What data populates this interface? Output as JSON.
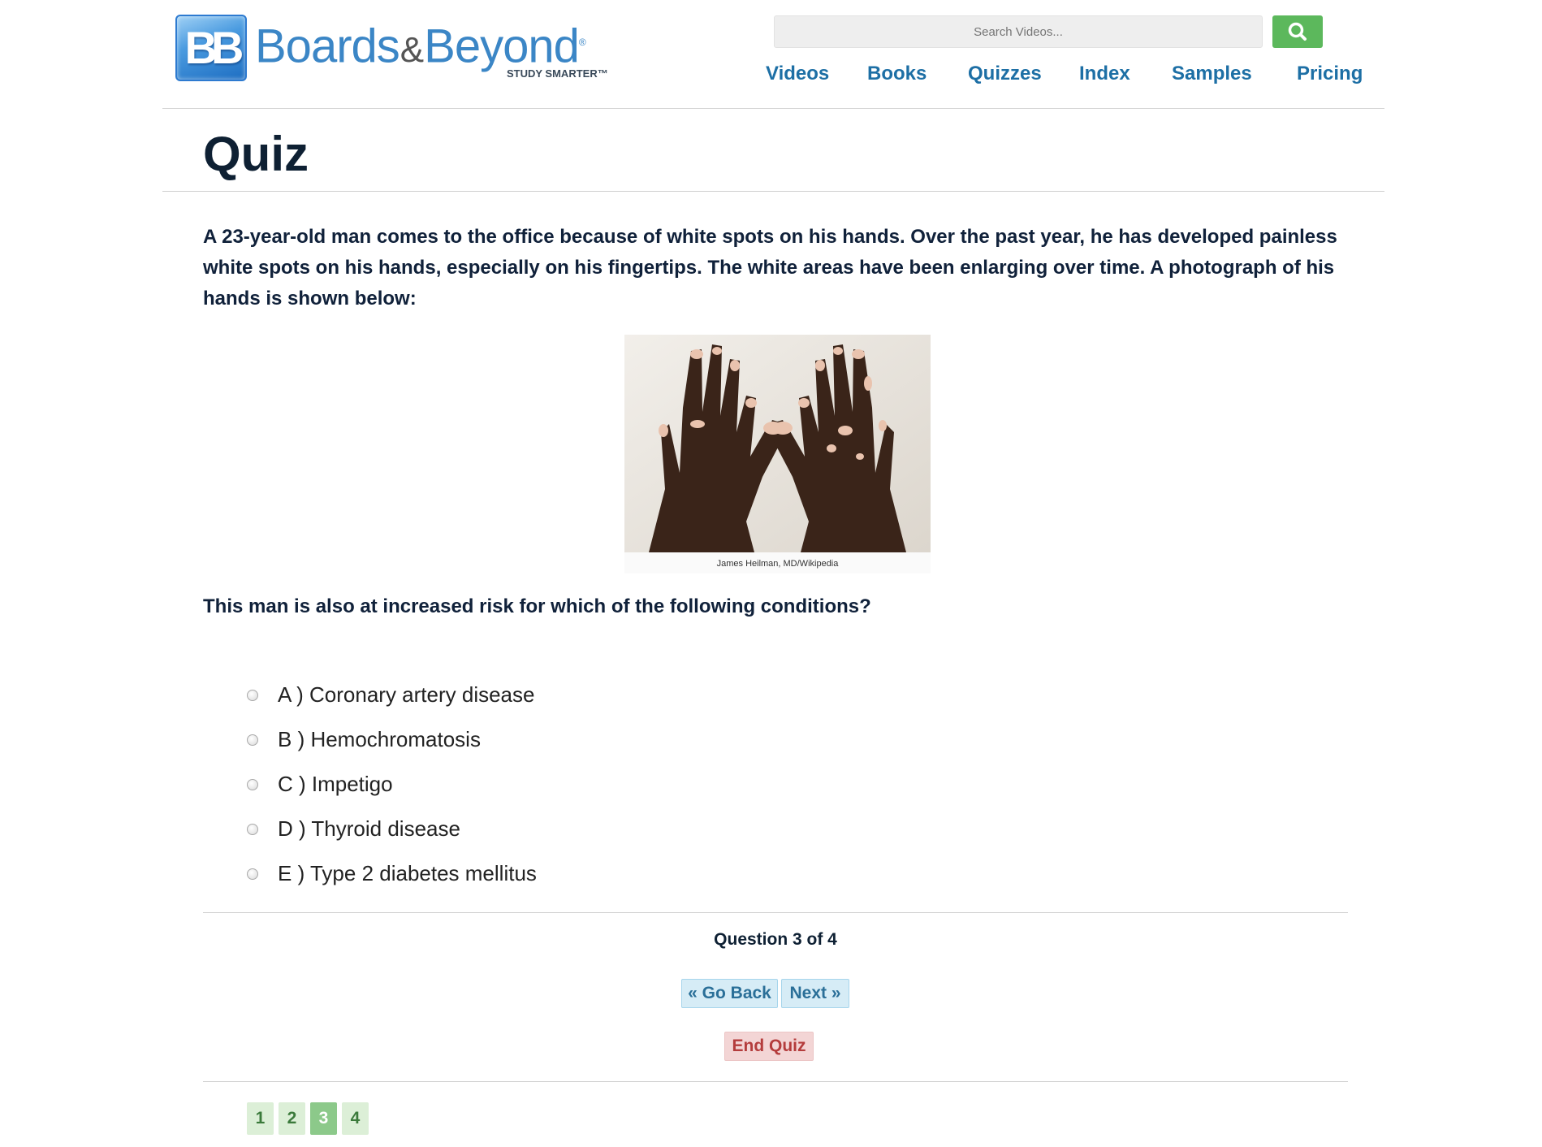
{
  "brand": {
    "mark": "BB",
    "name_left": "Boards",
    "name_amp": "&",
    "name_right": "Beyond",
    "registered": "®",
    "tagline": "STUDY SMARTER™"
  },
  "search": {
    "placeholder": "Search Videos...",
    "icon": "search-icon",
    "button_color": "#5cb85c"
  },
  "nav": {
    "items": [
      {
        "label": "Videos"
      },
      {
        "label": "Books"
      },
      {
        "label": "Quizzes"
      },
      {
        "label": "Index"
      },
      {
        "label": "Samples"
      },
      {
        "label": "Pricing"
      }
    ]
  },
  "page": {
    "title": "Quiz"
  },
  "question": {
    "stem": "A 23-year-old man comes to the office because of white spots on his hands. Over the past year, he has developed painless white spots on his hands, especially on his fingertips. The white areas have been enlarging over time. A photograph of his hands is shown below:",
    "image_credit": "James Heilman, MD/Wikipedia",
    "prompt": "This man is also at increased risk for which of the following conditions?",
    "options": [
      {
        "label": "A ) Coronary artery disease"
      },
      {
        "label": "B ) Hemochromatosis"
      },
      {
        "label": "C ) Impetigo"
      },
      {
        "label": "D ) Thyroid disease"
      },
      {
        "label": "E ) Type 2 diabetes mellitus"
      }
    ]
  },
  "progress": {
    "text": "Question 3 of 4",
    "current": 3,
    "total": 4
  },
  "controls": {
    "back_label": "« Go Back",
    "next_label": "Next »",
    "end_label": "End Quiz"
  },
  "pager": {
    "pages": [
      "1",
      "2",
      "3",
      "4"
    ],
    "current_index": 2
  },
  "colors": {
    "nav_link": "#1d6fa5",
    "title": "#0e2033",
    "end_button": "#b43c3c",
    "pager_current": "#8cc98a"
  }
}
